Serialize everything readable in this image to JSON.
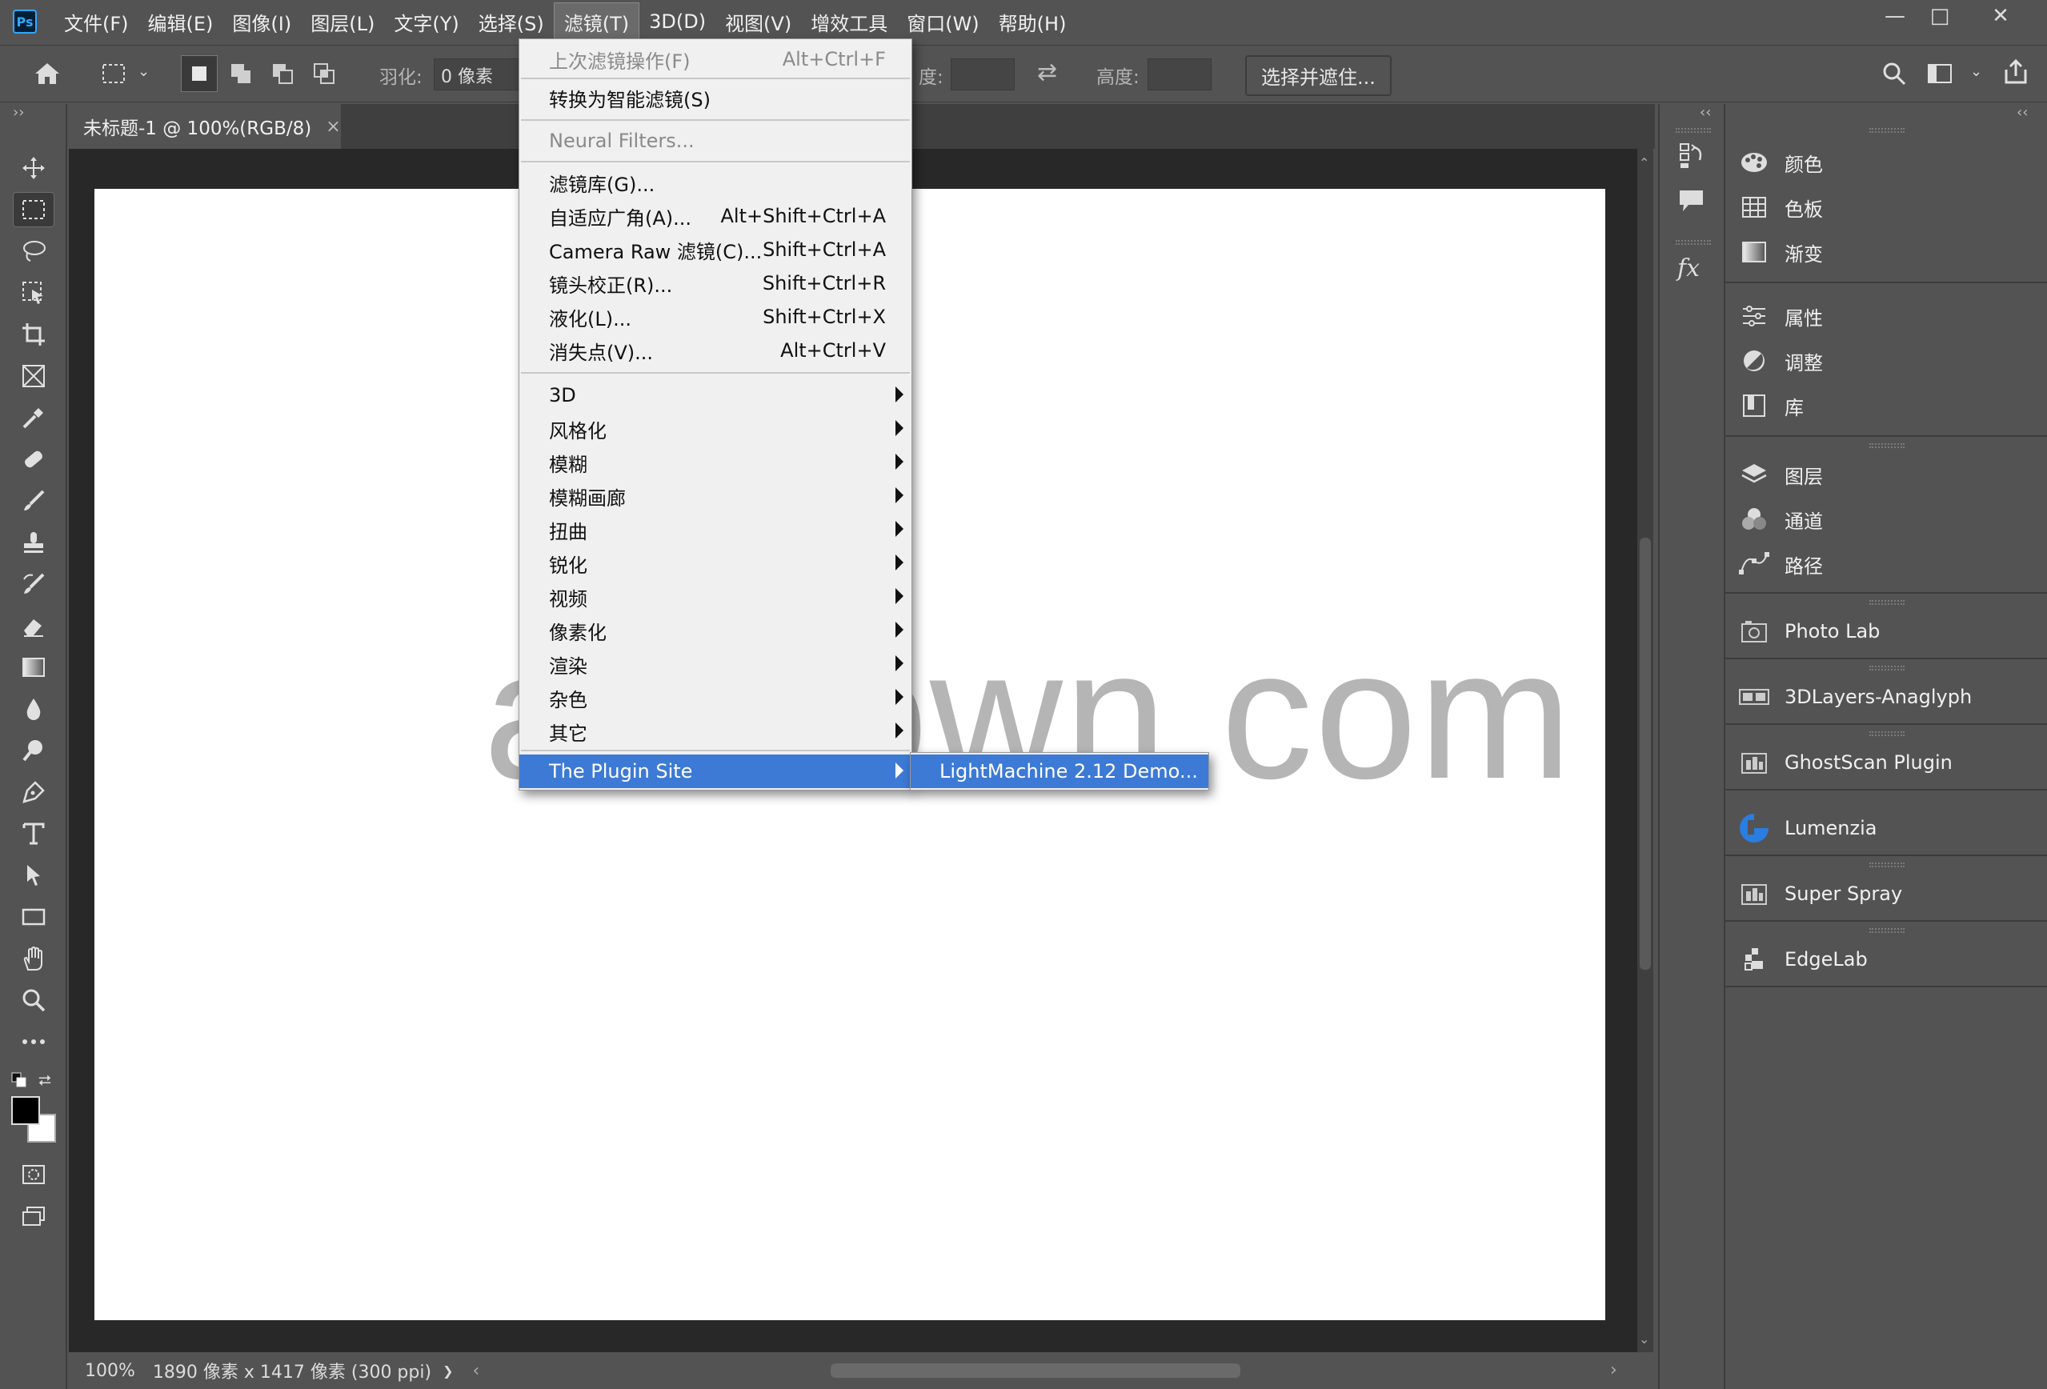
{
  "app": {
    "logo": "Ps"
  },
  "menubar": {
    "items": [
      "文件(F)",
      "编辑(E)",
      "图像(I)",
      "图层(L)",
      "文字(Y)",
      "选择(S)",
      "滤镜(T)",
      "3D(D)",
      "视图(V)",
      "增效工具",
      "窗口(W)",
      "帮助(H)"
    ],
    "active_index": 6
  },
  "window_controls": {
    "minimize": "—",
    "maximize": "□",
    "close": "✕"
  },
  "options": {
    "feather_label": "羽化:",
    "feather_value": "0 像素",
    "width_label": "度:",
    "height_label": "高度:",
    "select_mask_button": "选择并遮住..."
  },
  "document": {
    "tab_title": "未标题-1 @ 100%(RGB/8)",
    "tab_close": "×"
  },
  "status": {
    "zoom": "100%",
    "info": "1890 像素 x 1417 像素 (300 ppi)",
    "arrow": "❯",
    "left_arrow": "‹",
    "right_arrow": "›"
  },
  "filter_menu": {
    "last_filter": {
      "label": "上次滤镜操作(F)",
      "shortcut": "Alt+Ctrl+F"
    },
    "convert_smart": {
      "label": "转换为智能滤镜(S)"
    },
    "neural": {
      "label": "Neural Filters..."
    },
    "gallery": {
      "label": "滤镜库(G)..."
    },
    "adaptive": {
      "label": "自适应广角(A)...",
      "shortcut": "Alt+Shift+Ctrl+A"
    },
    "camera_raw": {
      "label": "Camera Raw 滤镜(C)...",
      "shortcut": "Shift+Ctrl+A"
    },
    "lens": {
      "label": "镜头校正(R)...",
      "shortcut": "Shift+Ctrl+R"
    },
    "liquify": {
      "label": "液化(L)...",
      "shortcut": "Shift+Ctrl+X"
    },
    "vanishing": {
      "label": "消失点(V)...",
      "shortcut": "Alt+Ctrl+V"
    },
    "submenus": [
      "3D",
      "风格化",
      "模糊",
      "模糊画廊",
      "扭曲",
      "锐化",
      "视频",
      "像素化",
      "渲染",
      "杂色",
      "其它"
    ],
    "plugin_site": {
      "label": "The Plugin Site"
    }
  },
  "plugin_submenu": {
    "item": "LightMachine 2.12 Demo..."
  },
  "panels": {
    "group1": [
      "颜色",
      "色板",
      "渐变"
    ],
    "group2": [
      "属性",
      "调整",
      "库"
    ],
    "group3": [
      "图层",
      "通道",
      "路径"
    ],
    "plugins": [
      "Photo Lab",
      "3DLayers-Anaglyph",
      "GhostScan Plugin",
      "Lumenzia",
      "Super Spray",
      "EdgeLab"
    ]
  },
  "iconcol": {
    "fx": "fx"
  },
  "collapse": {
    "left": "››",
    "right": "‹‹",
    "mid": "‹‹"
  },
  "watermark": "awdown.com",
  "colors": {
    "accent": "#3d7ad6",
    "bg": "#535353",
    "canvas": "#ffffff",
    "lumenzia": "#2a7de1"
  }
}
